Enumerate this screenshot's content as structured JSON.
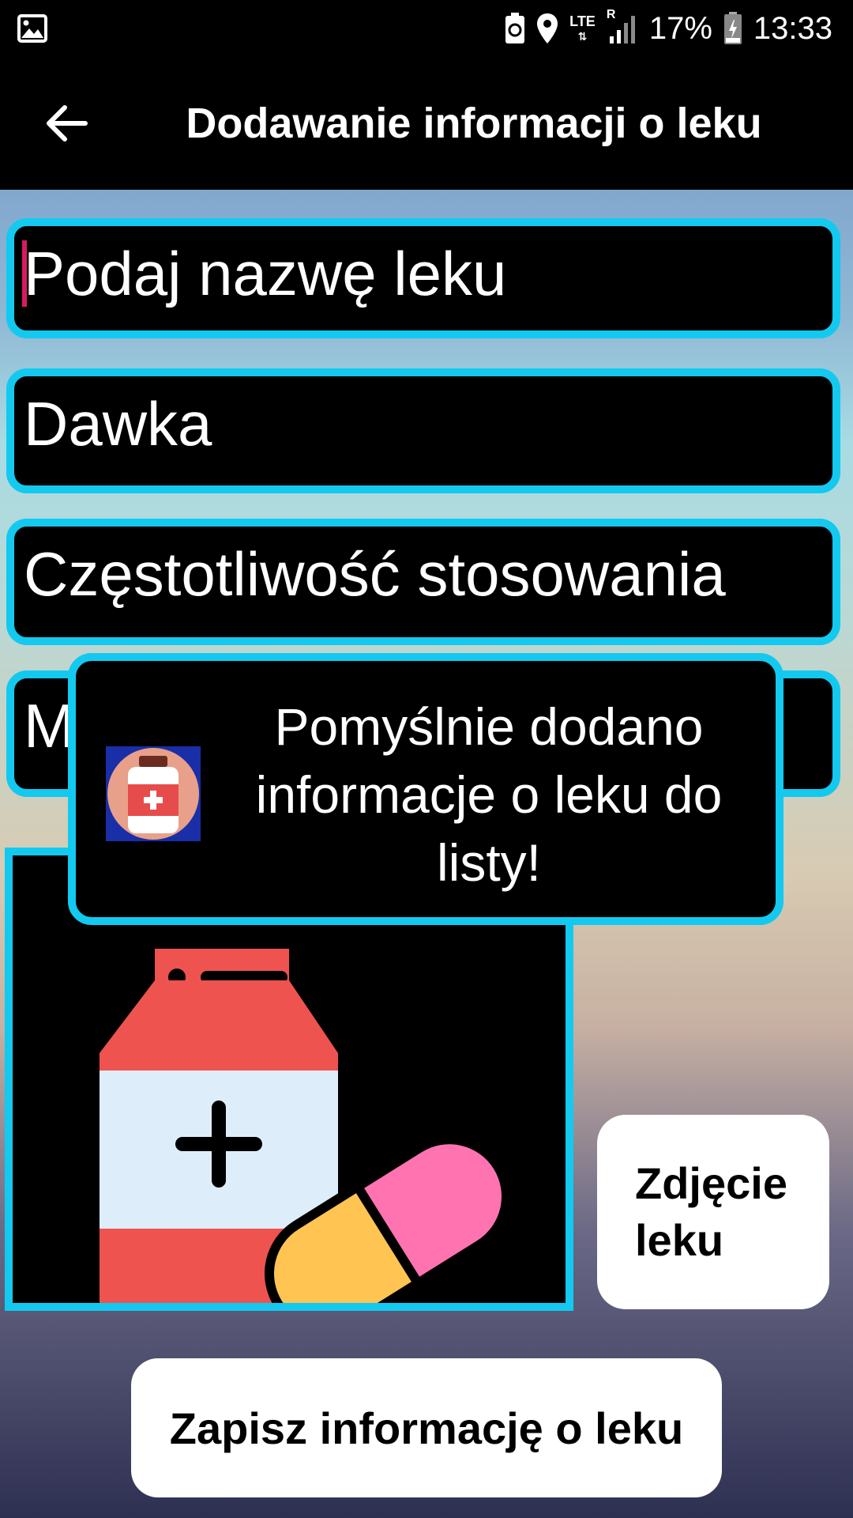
{
  "status_bar": {
    "battery_percent": "17%",
    "time": "13:33",
    "network_type": "LTE",
    "roaming": "R",
    "icons": [
      "gallery-icon",
      "battery-saver-icon",
      "location-icon",
      "lte-icon",
      "signal-icon",
      "battery-icon"
    ]
  },
  "app_bar": {
    "title": "Dodawanie informacji o leku",
    "back_icon": "arrow-left-icon"
  },
  "form": {
    "name_placeholder": "Podaj nazwę leku",
    "dose_placeholder": "Dawka",
    "frequency_placeholder": "Częstotliwość stosowania",
    "fourth_field_visible_text": "M"
  },
  "image_box": {
    "icon": "medicine-bottle-and-pill-icon"
  },
  "buttons": {
    "photo_label": "Zdjęcie leku",
    "save_label": "Zapisz informację o leku"
  },
  "toast": {
    "icon": "app-medicine-icon",
    "message": "Pomyślnie dodano informacje o leku do listy!"
  },
  "colors": {
    "accent_border": "#13c9ef",
    "cursor": "#d81b60",
    "bottle_red": "#ee5350",
    "pill_pink": "#ff73b0",
    "pill_yellow": "#ffc452"
  }
}
